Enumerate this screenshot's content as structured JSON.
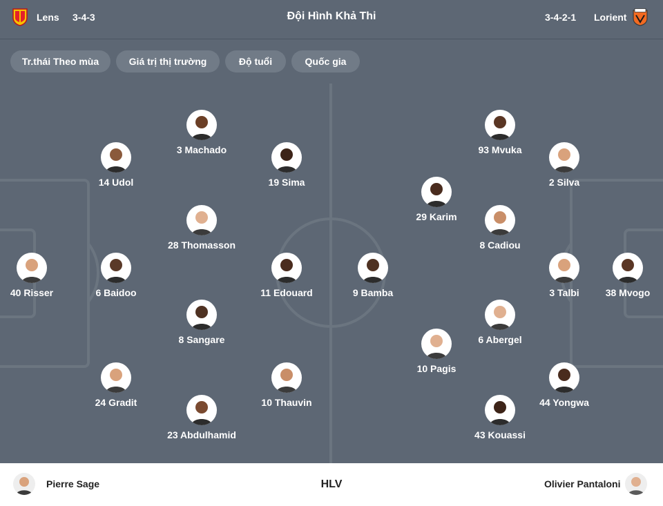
{
  "header": {
    "title": "Đội Hình Khả Thi",
    "home": {
      "name": "Lens",
      "formation": "3-4-3",
      "logo_icon": "rc-lens-crest-icon",
      "color": "#e4202a"
    },
    "away": {
      "name": "Lorient",
      "formation": "3-4-2-1",
      "logo_icon": "fc-lorient-crest-icon",
      "color": "#f26a21"
    }
  },
  "filters": [
    "Tr.thái Theo mùa",
    "Giá trị thị trường",
    "Độ tuổi",
    "Quốc gia"
  ],
  "players": {
    "home": [
      "40 Risser",
      "14 Udol",
      "6 Baidoo",
      "24 Gradit",
      "3 Machado",
      "28 Thomasson",
      "8 Sangare",
      "23 Abdulhamid",
      "19 Sima",
      "11 Edouard",
      "10 Thauvin"
    ],
    "away": [
      "93 Mvuka",
      "2 Silva",
      "29 Karim",
      "8 Cadiou",
      "9 Bamba",
      "3 Talbi",
      "38 Mvogo",
      "6 Abergel",
      "10 Pagis",
      "44 Yongwa",
      "43 Kouassi"
    ]
  },
  "coaches": {
    "label": "HLV",
    "home": "Pierre Sage",
    "away": "Olivier Pantaloni"
  },
  "colors": {
    "panel": "#5d6774",
    "chip": "#717b87",
    "pitch_lines": "#6b7580"
  }
}
